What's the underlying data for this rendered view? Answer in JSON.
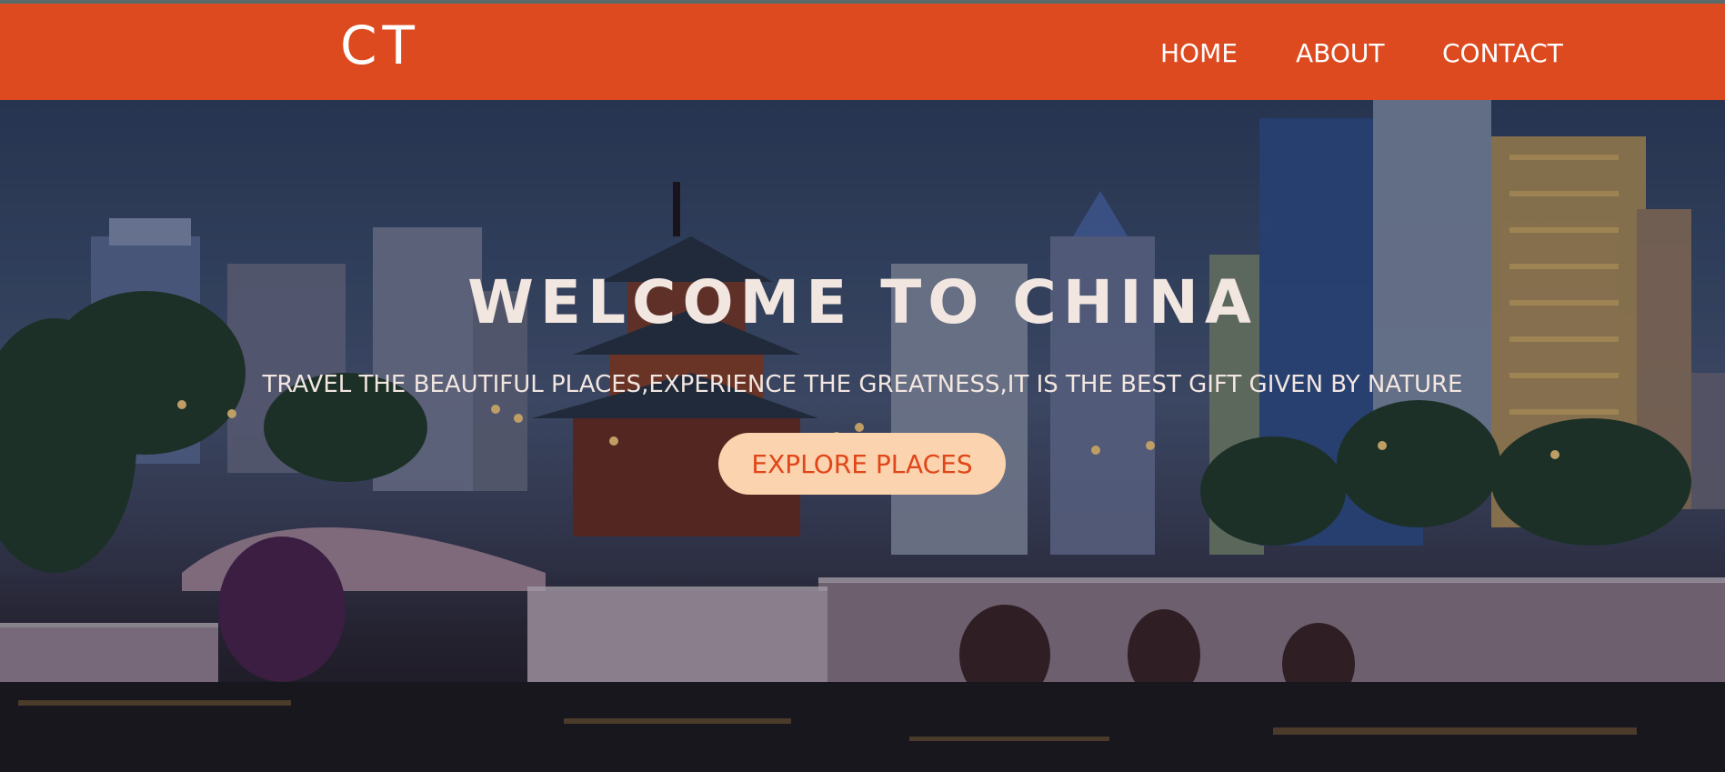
{
  "header": {
    "logo": "CT",
    "nav": [
      {
        "label": "HOME"
      },
      {
        "label": "ABOUT"
      },
      {
        "label": "CONTACT"
      }
    ]
  },
  "hero": {
    "title": "WELCOME TO CHINA",
    "subtitle": "TRAVEL THE BEAUTIFUL PLACES,EXPERIENCE THE GREATNESS,IT IS THE BEST GIFT GIVEN BY NATURE",
    "cta_label": "EXPLORE PLACES"
  },
  "colors": {
    "navbar": "#dd4a1f",
    "cta_background": "#fbd3ae",
    "cta_text": "#e0461a",
    "hero_text": "#f2e6e0"
  }
}
